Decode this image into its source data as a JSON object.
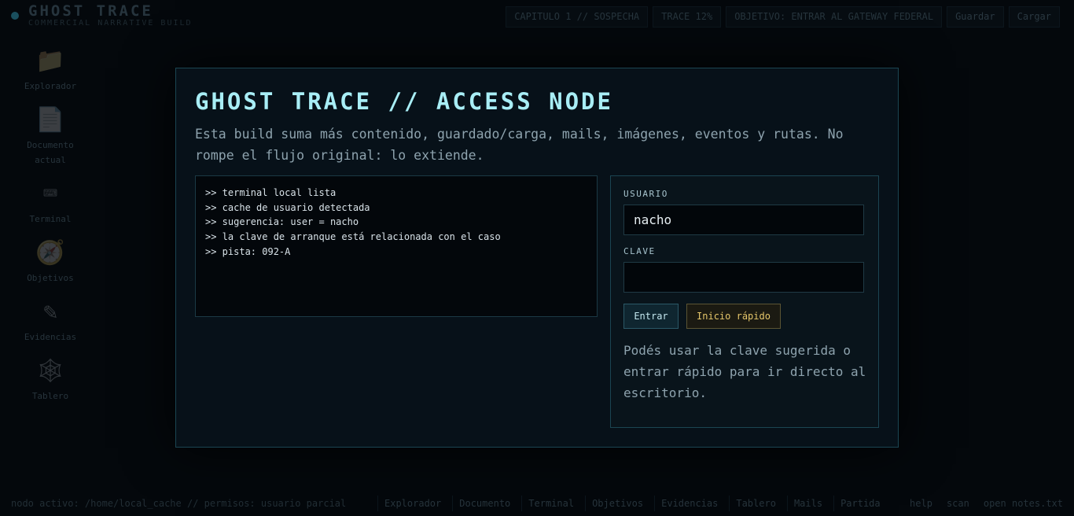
{
  "app": {
    "title": "GHOST TRACE",
    "subtitle": "COMMERCIAL NARRATIVE BUILD"
  },
  "status": {
    "chapter": "CAPITULO 1 // SOSPECHA",
    "trace": "TRACE 12%",
    "objective": "OBJETIVO: ENTRAR AL GATEWAY FEDERAL",
    "save_label": "Guardar",
    "load_label": "Cargar"
  },
  "sidebar": {
    "items": [
      {
        "label": "Explorador",
        "icon": "📁"
      },
      {
        "label": "Documento actual",
        "icon": "📄"
      },
      {
        "label": "Terminal",
        "icon": "⌨"
      },
      {
        "label": "Objetivos",
        "icon": "🧭"
      },
      {
        "label": "Evidencias",
        "icon": "✎"
      },
      {
        "label": "Tablero",
        "icon": "🕸"
      }
    ]
  },
  "bottombar": {
    "path": "nodo activo: /home/local_cache // permisos: usuario parcial",
    "tabs": [
      "Explorador",
      "Documento",
      "Terminal",
      "Objetivos",
      "Evidencias",
      "Tablero",
      "Mails",
      "Partida"
    ],
    "right": [
      "help",
      "scan",
      "open notes.txt"
    ]
  },
  "modal": {
    "title": "GHOST TRACE // ACCESS NODE",
    "description": "Esta build suma más contenido, guardado/carga, mails, imágenes, eventos y rutas. No rompe el flujo original: lo extiende.",
    "terminal_lines": [
      ">> terminal local lista",
      ">> cache de usuario detectada",
      ">> sugerencia: user = nacho",
      ">> la clave de arranque está relacionada con el caso",
      ">> pista: 092-A"
    ],
    "login": {
      "user_label": "USUARIO",
      "user_value": "nacho",
      "password_label": "CLAVE",
      "password_value": "",
      "enter_label": "Entrar",
      "quick_label": "Inicio rápido",
      "hint": "Podés usar la clave sugerida o entrar rápido para ir directo al escritorio."
    }
  }
}
